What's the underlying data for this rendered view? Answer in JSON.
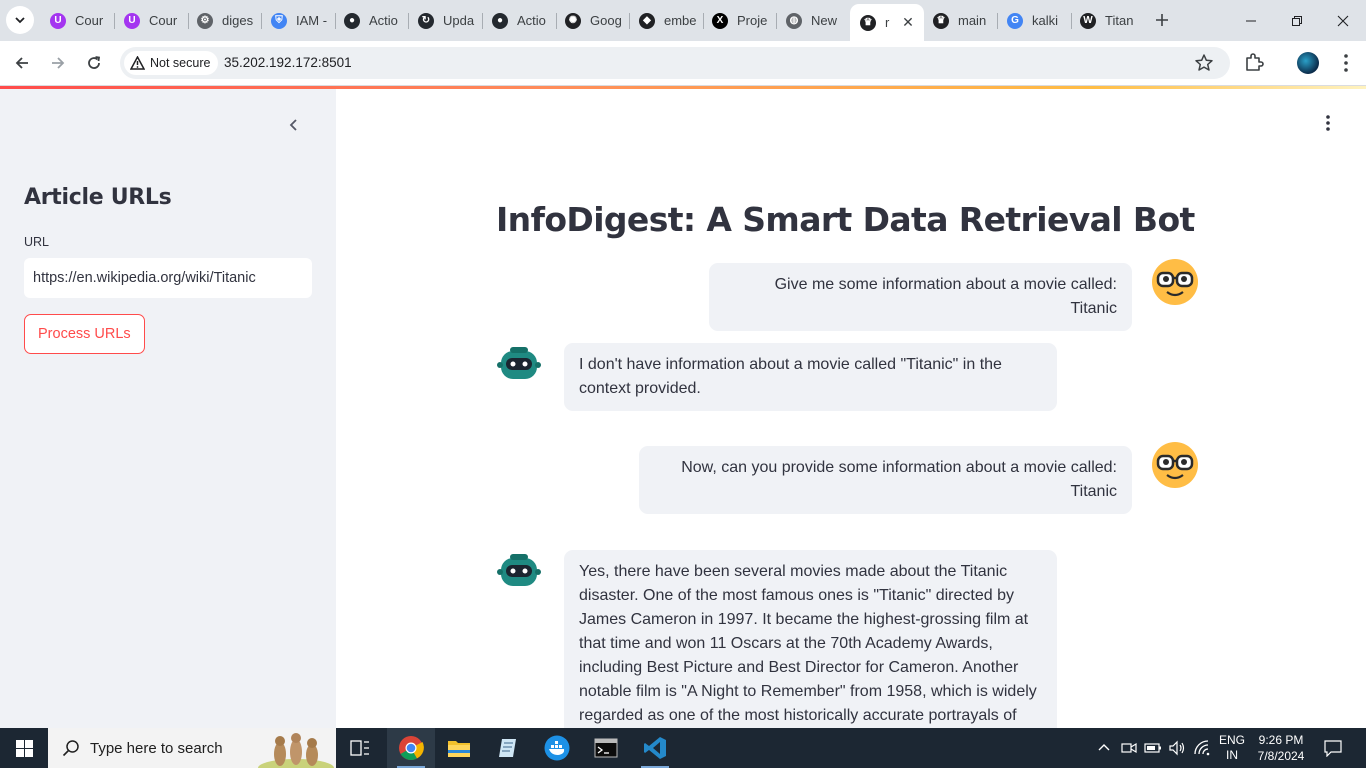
{
  "browser": {
    "tabs": [
      {
        "title": "Cour",
        "favicon": "udemy-icon",
        "color": "#a435f0"
      },
      {
        "title": "Cour",
        "favicon": "udemy-icon",
        "color": "#a435f0"
      },
      {
        "title": "diges",
        "favicon": "gear-icon",
        "color": "#5f6368"
      },
      {
        "title": "IAM -",
        "favicon": "shield-icon",
        "color": "#4285f4"
      },
      {
        "title": "Actio",
        "favicon": "github-icon",
        "color": "#24292f"
      },
      {
        "title": "Upda",
        "favicon": "sync-icon",
        "color": "#24292f"
      },
      {
        "title": "Actio",
        "favicon": "github-icon",
        "color": "#24292f"
      },
      {
        "title": "Goog",
        "favicon": "openai-icon",
        "color": "#202124"
      },
      {
        "title": "embe",
        "favicon": "cohere-icon",
        "color": "#202124"
      },
      {
        "title": "Proje",
        "favicon": "x-logo-icon",
        "color": "#000000"
      },
      {
        "title": "New",
        "favicon": "globe-icon",
        "color": "#5f6368"
      },
      {
        "title": "r",
        "favicon": "streamlit-icon",
        "color": "#202124",
        "active": true
      },
      {
        "title": "main",
        "favicon": "streamlit-icon",
        "color": "#202124"
      },
      {
        "title": "kalki",
        "favicon": "google-icon",
        "color": "#4285f4"
      },
      {
        "title": "Titan",
        "favicon": "wikipedia-icon",
        "color": "#202124"
      }
    ],
    "security_label": "Not secure",
    "url": "35.202.192.172:8501"
  },
  "sidebar": {
    "heading": "Article URLs",
    "url_label": "URL",
    "url_value": "https://en.wikipedia.org/wiki/Titanic",
    "process_button": "Process URLs"
  },
  "main": {
    "title": "InfoDigest: A Smart Data Retrieval Bot",
    "messages": [
      {
        "role": "user",
        "text": "Give me some information about a movie called: Titanic"
      },
      {
        "role": "assistant",
        "text": "I don't have information about a movie called \"Titanic\" in the context provided."
      },
      {
        "role": "user",
        "text": "Now, can you provide some information about a movie called: Titanic"
      },
      {
        "role": "assistant",
        "text": "Yes, there have been several movies made about the Titanic disaster. One of the most famous ones is \"Titanic\" directed by James Cameron in 1997. It became the highest-grossing film at that time and won 11 Oscars at the 70th Academy Awards, including Best Picture and Best Director for Cameron. Another notable film is \"A Night to Remember\" from 1958, which is widely regarded as one of the most historically accurate portrayals of"
      }
    ]
  },
  "taskbar": {
    "search_placeholder": "Type here to search",
    "lang_top": "ENG",
    "lang_bottom": "IN",
    "time": "9:26 PM",
    "date": "7/8/2024"
  },
  "colors": {
    "accent": "#ff4b4b",
    "sidebar_bg": "#f0f2f6",
    "text": "#31333f"
  }
}
